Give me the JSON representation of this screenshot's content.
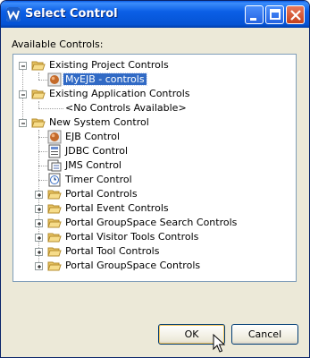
{
  "window": {
    "title": "Select Control"
  },
  "label": "Available Controls:",
  "tree": {
    "existing_project": "Existing Project Controls",
    "myejb": "MyEJB - controls",
    "existing_app": "Existing Application Controls",
    "no_controls": "<No Controls Available>",
    "new_system": "New System Control",
    "ejb": "EJB Control",
    "jdbc": "JDBC Control",
    "jms": "JMS Control",
    "timer": "Timer Control",
    "portal_controls": "Portal Controls",
    "portal_event": "Portal Event Controls",
    "portal_groupspace_search": "Portal GroupSpace Search Controls",
    "portal_visitor_tools": "Portal Visitor Tools Controls",
    "portal_tool": "Portal Tool Controls",
    "portal_groupspace": "Portal GroupSpace Controls"
  },
  "buttons": {
    "ok": "OK",
    "cancel": "Cancel"
  },
  "icons": {
    "window": "weblogic-w-icon",
    "folder": "folder-open-icon",
    "ejb": "ejb-bean-icon",
    "jdbc": "database-icon",
    "jms": "message-icon",
    "timer": "timer-icon"
  },
  "colors": {
    "titlebar": "#0553d4",
    "selection": "#316ac5"
  }
}
